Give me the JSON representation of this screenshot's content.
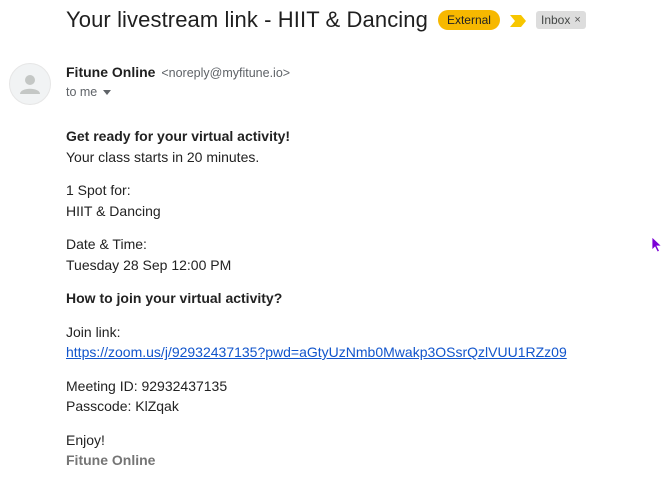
{
  "subject": {
    "title": "Your livestream link - HIIT & Dancing",
    "external_label": "External",
    "inbox_label": "Inbox",
    "inbox_close": "×",
    "external_color": "#f7b800",
    "importance_color": "#f7c600"
  },
  "sender": {
    "name": "Fitune Online",
    "email": "<noreply@myfitune.io>",
    "to": "to me"
  },
  "email_body": {
    "heading": "Get ready for your virtual activity!",
    "starts": "Your class starts in 20 minutes.",
    "spot_label": "1 Spot for:",
    "spot_value": "HIIT & Dancing",
    "datetime_label": "Date & Time:",
    "datetime_value": "Tuesday 28 Sep 12:00 PM",
    "how_to_join": "How to join your virtual activity?",
    "join_label": "Join link:",
    "join_url": "https://zoom.us/j/92932437135?pwd=aGtyUzNmb0Mwakp3OSsrQzlVUU1RZz09",
    "meeting_id": "Meeting ID: 92932437135",
    "passcode": "Passcode: KlZqak",
    "closing": "Enjoy!",
    "signature": "Fitune Online"
  }
}
